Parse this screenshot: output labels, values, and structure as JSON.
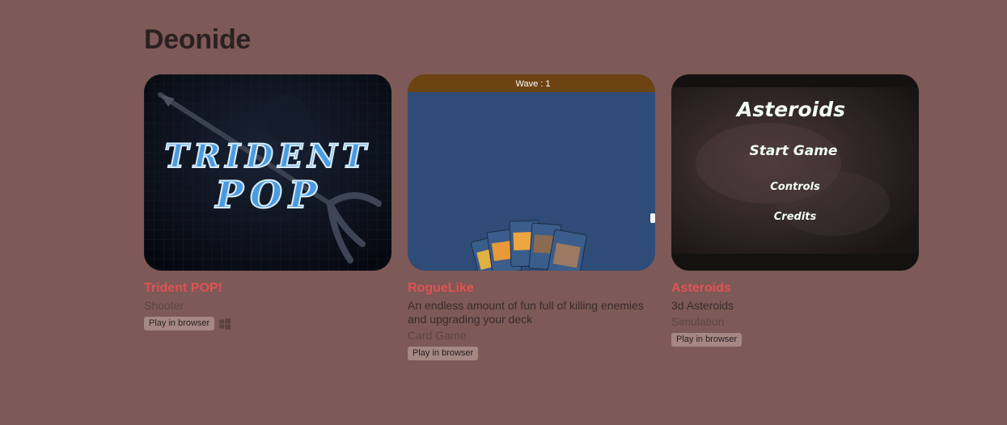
{
  "page": {
    "title": "Deonide"
  },
  "games": [
    {
      "title": "Trident POP!",
      "genre": "Shooter",
      "badge": "Play in browser",
      "platform_icon": "windows-icon",
      "thumbnail": {
        "logo_line1": "TRIDENT",
        "logo_line2": "POP"
      }
    },
    {
      "title": "RogueLike",
      "description": "An endless amount of fun full of killing enemies and upgrading your deck",
      "genre": "Card Game",
      "badge": "Play in browser",
      "thumbnail": {
        "wave_label": "Wave : 1"
      }
    },
    {
      "title": "Asteroids",
      "description": "3d Asteroids",
      "genre": "Simulation",
      "badge": "Play in browser",
      "thumbnail": {
        "menu_title": "Asteroids",
        "menu_items": [
          "Start Game",
          "Controls",
          "Credits"
        ]
      }
    }
  ],
  "colors": {
    "background": "#7d5957",
    "title_link": "#e05252",
    "heading": "#2a2020"
  }
}
